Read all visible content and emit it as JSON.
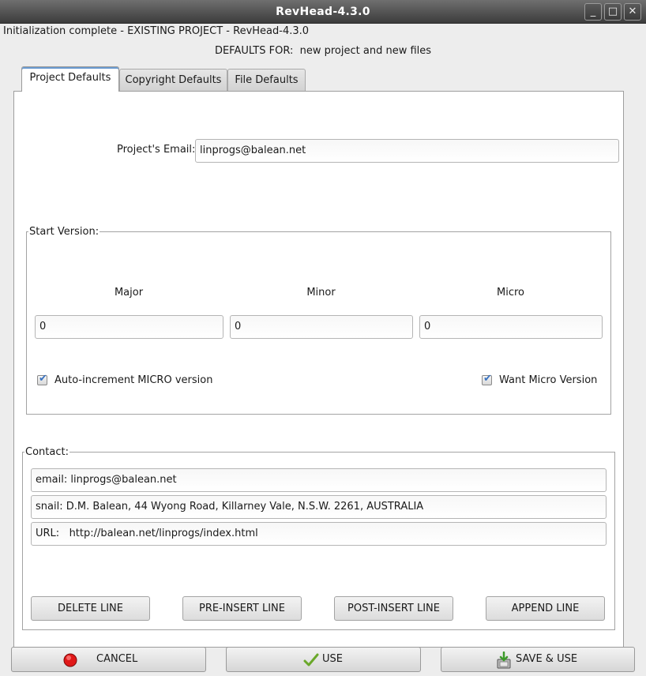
{
  "window": {
    "title": "RevHead-4.3.0",
    "controls": {
      "minimize": "_",
      "maximize": "□",
      "close": "✕"
    }
  },
  "status_text": "Initialization complete - EXISTING PROJECT - RevHead-4.3.0",
  "defaults_heading": "DEFAULTS FOR:  new project and new files",
  "tabs": [
    {
      "label": "Project Defaults",
      "active": true
    },
    {
      "label": "Copyright Defaults",
      "active": false
    },
    {
      "label": "File Defaults",
      "active": false
    }
  ],
  "project_email": {
    "label": "Project's Email:",
    "value": "linprogs@balean.net"
  },
  "start_version": {
    "legend": "Start Version:",
    "columns": [
      {
        "label": "Major",
        "value": "0"
      },
      {
        "label": "Minor",
        "value": "0"
      },
      {
        "label": "Micro",
        "value": "0"
      }
    ],
    "auto_increment": {
      "label": "Auto-increment MICRO version",
      "checked": true
    },
    "want_micro": {
      "label": "Want Micro Version",
      "checked": true
    }
  },
  "contact": {
    "legend": "Contact:",
    "lines": [
      "email: linprogs@balean.net",
      "snail: D.M. Balean, 44 Wyong Road, Killarney Vale, N.S.W. 2261, AUSTRALIA",
      "URL:   http://balean.net/linprogs/index.html"
    ],
    "buttons": {
      "delete": "DELETE LINE",
      "pre_insert": "PRE-INSERT LINE",
      "post_insert": "POST-INSERT LINE",
      "append": "APPEND LINE"
    }
  },
  "footer": {
    "cancel": "CANCEL",
    "use": "USE",
    "save_use": "SAVE & USE"
  },
  "colors": {
    "titlebar": "#4a4a4a",
    "cancel_icon": "#e01818",
    "use_icon": "#6aa82a",
    "check_mark": "#3a73c0"
  }
}
